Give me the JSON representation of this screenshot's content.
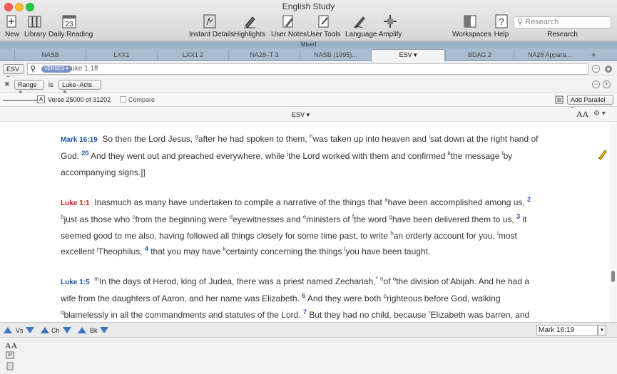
{
  "window": {
    "title": "English Study"
  },
  "toolbar": {
    "new": "New",
    "library": "Library",
    "daily_reading": "Daily Reading",
    "calendar_day": "23",
    "instant_details": "Instant Details",
    "highlights": "Highlights",
    "user_notes": "User Notes",
    "user_tools": "User Tools",
    "language": "Language",
    "amplify": "Amplify",
    "workspaces": "Workspaces",
    "help": "Help",
    "help_glyph": "?",
    "research_placeholder": "Research",
    "research_label": "Research"
  },
  "mixed_label": "Mixed",
  "tabs": [
    "NASB",
    "LXX1",
    "LXX1 2",
    "NA28–T 3",
    "NASB (1995)...",
    "ESV",
    "BDAG 2",
    "NA28 Appara..."
  ],
  "tab_add": "+",
  "search": {
    "version": "ESV",
    "version_arrow": "▾",
    "mode_pill": "VERSES ▾",
    "query": "luke 1.1ff",
    "range_label": "Range",
    "is_label": "is",
    "range_value": "Luke–Acts",
    "updown": "⇕",
    "minus": "−",
    "plus": "+",
    "close": "✖"
  },
  "info": {
    "knob": "A",
    "verse_count": "Verse 25000 of 31202",
    "compare": "Compare",
    "add_parallel": "Add Parallel",
    "add_parallel_arrow": "▾"
  },
  "header": {
    "version": "ESV",
    "version_arrow": "▾",
    "text_size": "AA",
    "gear_arrow": "▾"
  },
  "nav": {
    "verse": "Vs",
    "chapter": "Ch",
    "book": "Bk",
    "current_ref": "Mark 16:19",
    "drop": "▾"
  },
  "bottom": {
    "text_size": "AA"
  },
  "colors": {
    "accent": "#1d55a0",
    "luke_ref": "#c41b1b",
    "tab_strip": "#a9bdd0"
  }
}
